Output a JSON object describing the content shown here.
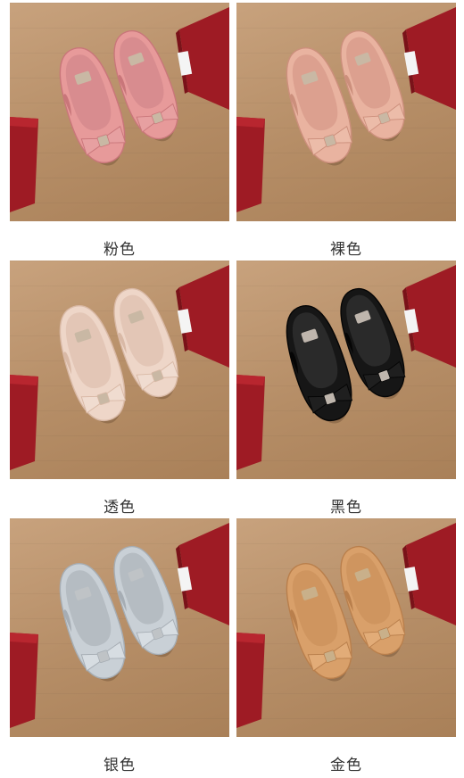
{
  "products": [
    {
      "label": "粉色",
      "shoe_color": "#e79a9a",
      "shoe_shade": "#c9767a",
      "bow_color": "#e7a0a1",
      "plate_color": "#c9b8a4",
      "insole_color": "#d88c8f"
    },
    {
      "label": "裸色",
      "shoe_color": "#e9b3a0",
      "shoe_shade": "#cc8f7c",
      "bow_color": "#ecbca9",
      "plate_color": "#c9b8a4",
      "insole_color": "#dca08f"
    },
    {
      "label": "透色",
      "shoe_color": "#eed6c8",
      "shoe_shade": "#d9b9a6",
      "bow_color": "#f0dcd0",
      "plate_color": "#c9b8a4",
      "insole_color": "#e3c6b6"
    },
    {
      "label": "黑色",
      "shoe_color": "#161616",
      "shoe_shade": "#050505",
      "bow_color": "#1f1f1f",
      "plate_color": "#bfb6ad",
      "insole_color": "#2a2a2a"
    },
    {
      "label": "银色",
      "shoe_color": "#c9d0d6",
      "shoe_shade": "#a6adb4",
      "bow_color": "#d7dde2",
      "plate_color": "#bfc3c6",
      "insole_color": "#b5bcc2"
    },
    {
      "label": "金色",
      "shoe_color": "#d9a06a",
      "shoe_shade": "#b97f4c",
      "bow_color": "#e2ac78",
      "plate_color": "#c9b08a",
      "insole_color": "#cf955f"
    }
  ]
}
